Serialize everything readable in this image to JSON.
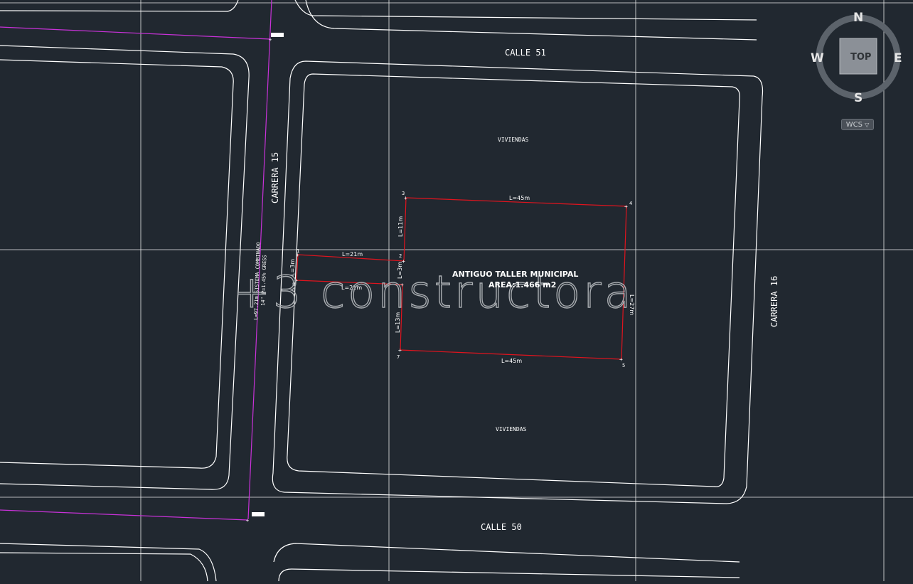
{
  "viewport": {
    "background": "#212830",
    "streets": {
      "calle_51": "CALLE 51",
      "calle_50": "CALLE 50",
      "carrera_15": "CARRERA 15",
      "carrera_16": "CARRERA 16"
    },
    "blocks": {
      "viviendas_top": "VIVIENDAS",
      "viviendas_bottom": "VIVIENDAS"
    },
    "lot": {
      "title": "ANTIGUO TALLER MUNICIPAL",
      "area": "AREA:1.466 m2",
      "dims": {
        "top": "L=45m",
        "bottom": "L=45m",
        "access_top": "L=21m",
        "access_bottom": "L=21m",
        "left_upper": "L=11m",
        "left_mid": "L=3m",
        "left_lower": "L=13m",
        "right": "L=27m",
        "access_left": "L=3m"
      },
      "vertices": [
        "1",
        "2",
        "3",
        "4",
        "5",
        "6",
        "7",
        "8"
      ]
    },
    "pipe_label_1": "L=97.21m SISTEMA COMBINADO",
    "pipe_label_2": "14\" P=1.45% GRESS",
    "watermark": "+3 constructora",
    "colors": {
      "lines": "#ffffff",
      "lot": "#e0141e",
      "pipe": "#c832d8",
      "grid": "#ffffff"
    }
  },
  "viewcube": {
    "top_label": "TOP",
    "north": "N",
    "south": "S",
    "east": "E",
    "west": "W",
    "wcs_label": "WCS"
  }
}
